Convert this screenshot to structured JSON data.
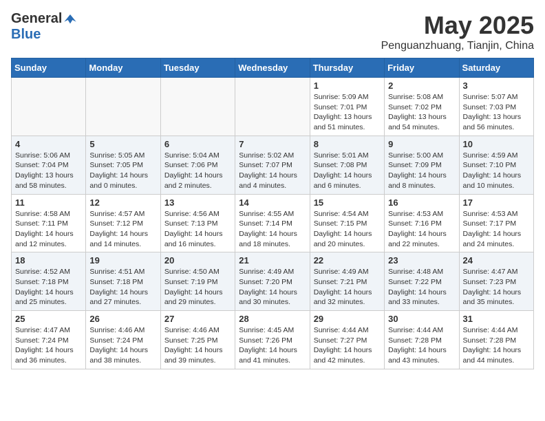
{
  "header": {
    "logo_general": "General",
    "logo_blue": "Blue",
    "title": "May 2025",
    "subtitle": "Penguanzhuang, Tianjin, China"
  },
  "days_of_week": [
    "Sunday",
    "Monday",
    "Tuesday",
    "Wednesday",
    "Thursday",
    "Friday",
    "Saturday"
  ],
  "weeks": [
    [
      {
        "day": "",
        "info": ""
      },
      {
        "day": "",
        "info": ""
      },
      {
        "day": "",
        "info": ""
      },
      {
        "day": "",
        "info": ""
      },
      {
        "day": "1",
        "info": "Sunrise: 5:09 AM\nSunset: 7:01 PM\nDaylight: 13 hours\nand 51 minutes."
      },
      {
        "day": "2",
        "info": "Sunrise: 5:08 AM\nSunset: 7:02 PM\nDaylight: 13 hours\nand 54 minutes."
      },
      {
        "day": "3",
        "info": "Sunrise: 5:07 AM\nSunset: 7:03 PM\nDaylight: 13 hours\nand 56 minutes."
      }
    ],
    [
      {
        "day": "4",
        "info": "Sunrise: 5:06 AM\nSunset: 7:04 PM\nDaylight: 13 hours\nand 58 minutes."
      },
      {
        "day": "5",
        "info": "Sunrise: 5:05 AM\nSunset: 7:05 PM\nDaylight: 14 hours\nand 0 minutes."
      },
      {
        "day": "6",
        "info": "Sunrise: 5:04 AM\nSunset: 7:06 PM\nDaylight: 14 hours\nand 2 minutes."
      },
      {
        "day": "7",
        "info": "Sunrise: 5:02 AM\nSunset: 7:07 PM\nDaylight: 14 hours\nand 4 minutes."
      },
      {
        "day": "8",
        "info": "Sunrise: 5:01 AM\nSunset: 7:08 PM\nDaylight: 14 hours\nand 6 minutes."
      },
      {
        "day": "9",
        "info": "Sunrise: 5:00 AM\nSunset: 7:09 PM\nDaylight: 14 hours\nand 8 minutes."
      },
      {
        "day": "10",
        "info": "Sunrise: 4:59 AM\nSunset: 7:10 PM\nDaylight: 14 hours\nand 10 minutes."
      }
    ],
    [
      {
        "day": "11",
        "info": "Sunrise: 4:58 AM\nSunset: 7:11 PM\nDaylight: 14 hours\nand 12 minutes."
      },
      {
        "day": "12",
        "info": "Sunrise: 4:57 AM\nSunset: 7:12 PM\nDaylight: 14 hours\nand 14 minutes."
      },
      {
        "day": "13",
        "info": "Sunrise: 4:56 AM\nSunset: 7:13 PM\nDaylight: 14 hours\nand 16 minutes."
      },
      {
        "day": "14",
        "info": "Sunrise: 4:55 AM\nSunset: 7:14 PM\nDaylight: 14 hours\nand 18 minutes."
      },
      {
        "day": "15",
        "info": "Sunrise: 4:54 AM\nSunset: 7:15 PM\nDaylight: 14 hours\nand 20 minutes."
      },
      {
        "day": "16",
        "info": "Sunrise: 4:53 AM\nSunset: 7:16 PM\nDaylight: 14 hours\nand 22 minutes."
      },
      {
        "day": "17",
        "info": "Sunrise: 4:53 AM\nSunset: 7:17 PM\nDaylight: 14 hours\nand 24 minutes."
      }
    ],
    [
      {
        "day": "18",
        "info": "Sunrise: 4:52 AM\nSunset: 7:18 PM\nDaylight: 14 hours\nand 25 minutes."
      },
      {
        "day": "19",
        "info": "Sunrise: 4:51 AM\nSunset: 7:18 PM\nDaylight: 14 hours\nand 27 minutes."
      },
      {
        "day": "20",
        "info": "Sunrise: 4:50 AM\nSunset: 7:19 PM\nDaylight: 14 hours\nand 29 minutes."
      },
      {
        "day": "21",
        "info": "Sunrise: 4:49 AM\nSunset: 7:20 PM\nDaylight: 14 hours\nand 30 minutes."
      },
      {
        "day": "22",
        "info": "Sunrise: 4:49 AM\nSunset: 7:21 PM\nDaylight: 14 hours\nand 32 minutes."
      },
      {
        "day": "23",
        "info": "Sunrise: 4:48 AM\nSunset: 7:22 PM\nDaylight: 14 hours\nand 33 minutes."
      },
      {
        "day": "24",
        "info": "Sunrise: 4:47 AM\nSunset: 7:23 PM\nDaylight: 14 hours\nand 35 minutes."
      }
    ],
    [
      {
        "day": "25",
        "info": "Sunrise: 4:47 AM\nSunset: 7:24 PM\nDaylight: 14 hours\nand 36 minutes."
      },
      {
        "day": "26",
        "info": "Sunrise: 4:46 AM\nSunset: 7:24 PM\nDaylight: 14 hours\nand 38 minutes."
      },
      {
        "day": "27",
        "info": "Sunrise: 4:46 AM\nSunset: 7:25 PM\nDaylight: 14 hours\nand 39 minutes."
      },
      {
        "day": "28",
        "info": "Sunrise: 4:45 AM\nSunset: 7:26 PM\nDaylight: 14 hours\nand 41 minutes."
      },
      {
        "day": "29",
        "info": "Sunrise: 4:44 AM\nSunset: 7:27 PM\nDaylight: 14 hours\nand 42 minutes."
      },
      {
        "day": "30",
        "info": "Sunrise: 4:44 AM\nSunset: 7:28 PM\nDaylight: 14 hours\nand 43 minutes."
      },
      {
        "day": "31",
        "info": "Sunrise: 4:44 AM\nSunset: 7:28 PM\nDaylight: 14 hours\nand 44 minutes."
      }
    ]
  ]
}
